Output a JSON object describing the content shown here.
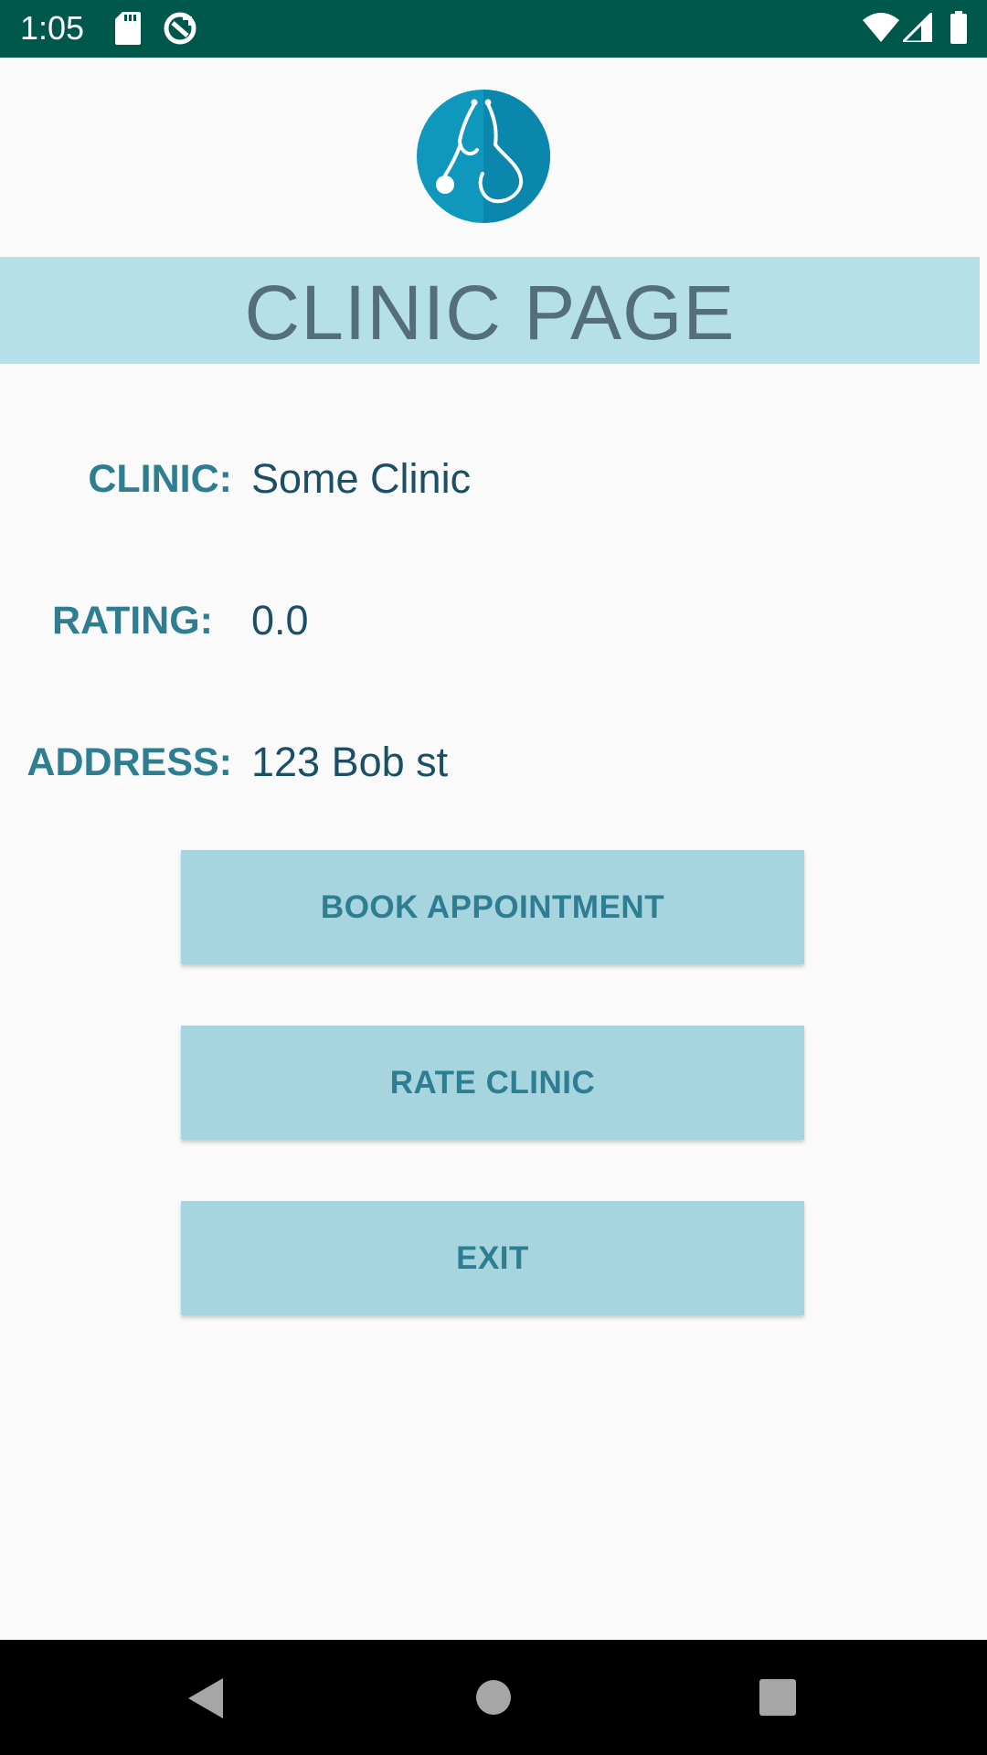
{
  "status_bar": {
    "time": "1:05",
    "icons": [
      "sd-card-icon",
      "sync-icon",
      "wifi-icon",
      "signal-icon",
      "battery-icon"
    ]
  },
  "logo": {
    "icon": "stethoscope-icon",
    "color": "#0f97bd"
  },
  "header": {
    "title": "CLINIC PAGE"
  },
  "info": {
    "clinic_label": "CLINIC:",
    "clinic_value": "Some Clinic",
    "rating_label": "RATING:",
    "rating_value": "0.0",
    "address_label": "ADDRESS:",
    "address_value": "123 Bob st"
  },
  "buttons": {
    "book": "BOOK APPOINTMENT",
    "rate": "RATE CLINIC",
    "exit": "EXIT"
  },
  "nav_bar": {
    "icons": [
      "back-icon",
      "home-icon",
      "recents-icon"
    ]
  },
  "colors": {
    "status_bar": "#00574b",
    "banner": "#b5e0ea",
    "button": "#a6d5e0",
    "label": "#2e7d91",
    "value": "#1a4f66",
    "title": "#546e7a"
  }
}
